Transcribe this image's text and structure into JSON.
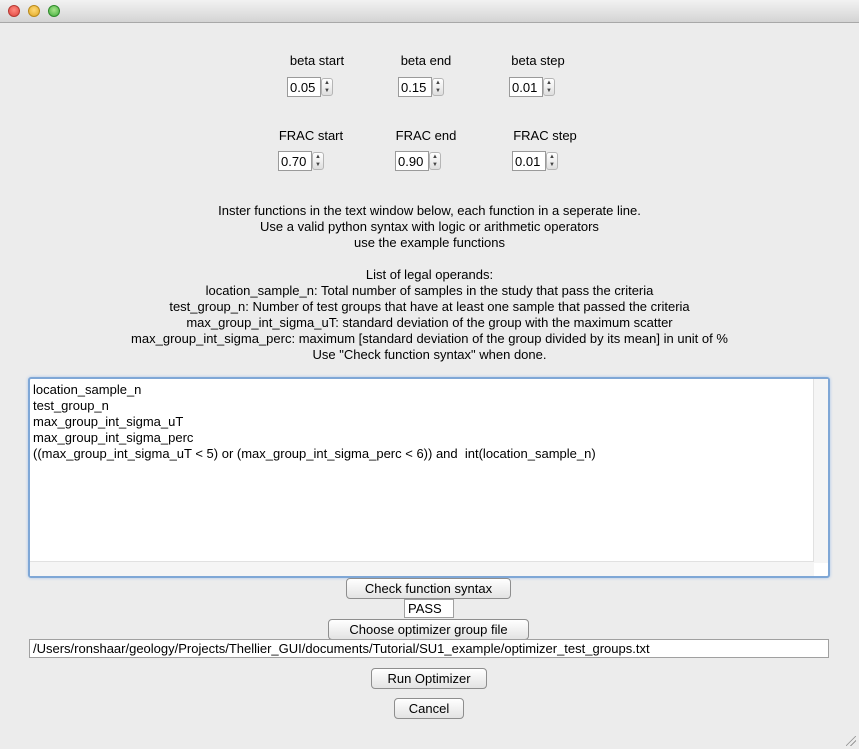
{
  "params": {
    "beta_start": {
      "label": "beta start",
      "value": "0.05"
    },
    "beta_end": {
      "label": "beta end",
      "value": "0.15"
    },
    "beta_step": {
      "label": "beta step",
      "value": "0.01"
    },
    "frac_start": {
      "label": "FRAC start",
      "value": "0.70"
    },
    "frac_end": {
      "label": "FRAC end",
      "value": "0.90"
    },
    "frac_step": {
      "label": "FRAC step",
      "value": "0.01"
    }
  },
  "instructions": [
    "Inster functions in the text window below, each function in a seperate line.",
    "Use a valid python syntax with logic or arithmetic operators",
    "use the example functions"
  ],
  "operands": [
    "List of legal operands:",
    "location_sample_n:  Total number of samples in the study that pass the criteria",
    "test_group_n:  Number of test groups that have at least one sample that passed the criteria",
    "max_group_int_sigma_uT:  standard deviation of the group with the maximum scatter",
    "max_group_int_sigma_perc:  maximum [standard deviation of the group divided by its mean] in unit of %",
    "Use \"Check function syntax\" when done."
  ],
  "functions_text": "location_sample_n\ntest_group_n\nmax_group_int_sigma_uT\nmax_group_int_sigma_perc\n((max_group_int_sigma_uT < 5) or (max_group_int_sigma_perc < 6)) and  int(location_sample_n)",
  "buttons": {
    "check_syntax": "Check function syntax",
    "choose_group_file": "Choose optimizer group file",
    "run_optimizer": "Run Optimizer",
    "cancel": "Cancel"
  },
  "syntax_status": "PASS",
  "group_file_path": "/Users/ronshaar/geology/Projects/Thellier_GUI/documents/Tutorial/SU1_example/optimizer_test_groups.txt"
}
